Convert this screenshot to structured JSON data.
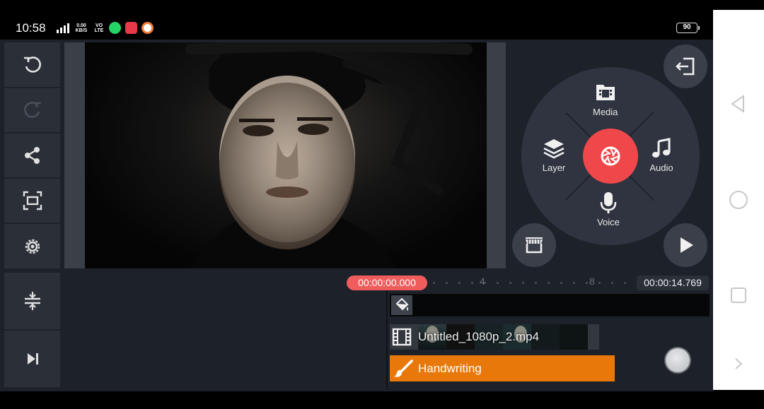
{
  "status_bar": {
    "time": "10:58",
    "net_speed": "0.00\nKB/S",
    "network_type": "VO\nLTE",
    "battery": "90"
  },
  "preview": {
    "description": "video preview"
  },
  "wheel": {
    "media_label": "Media",
    "layer_label": "Layer",
    "audio_label": "Audio",
    "voice_label": "Voice"
  },
  "timeline": {
    "current_time": "00:00:00.000",
    "ruler_marks": [
      "4",
      "8"
    ],
    "duration": "00:00:14.769",
    "video_clip": "Untitled_1080p_2.mp4",
    "handwriting_layer": "Handwriting"
  },
  "colors": {
    "accent_red": "#f0484a",
    "layer_orange": "#e8780a",
    "panel_bg": "#1d222a"
  }
}
